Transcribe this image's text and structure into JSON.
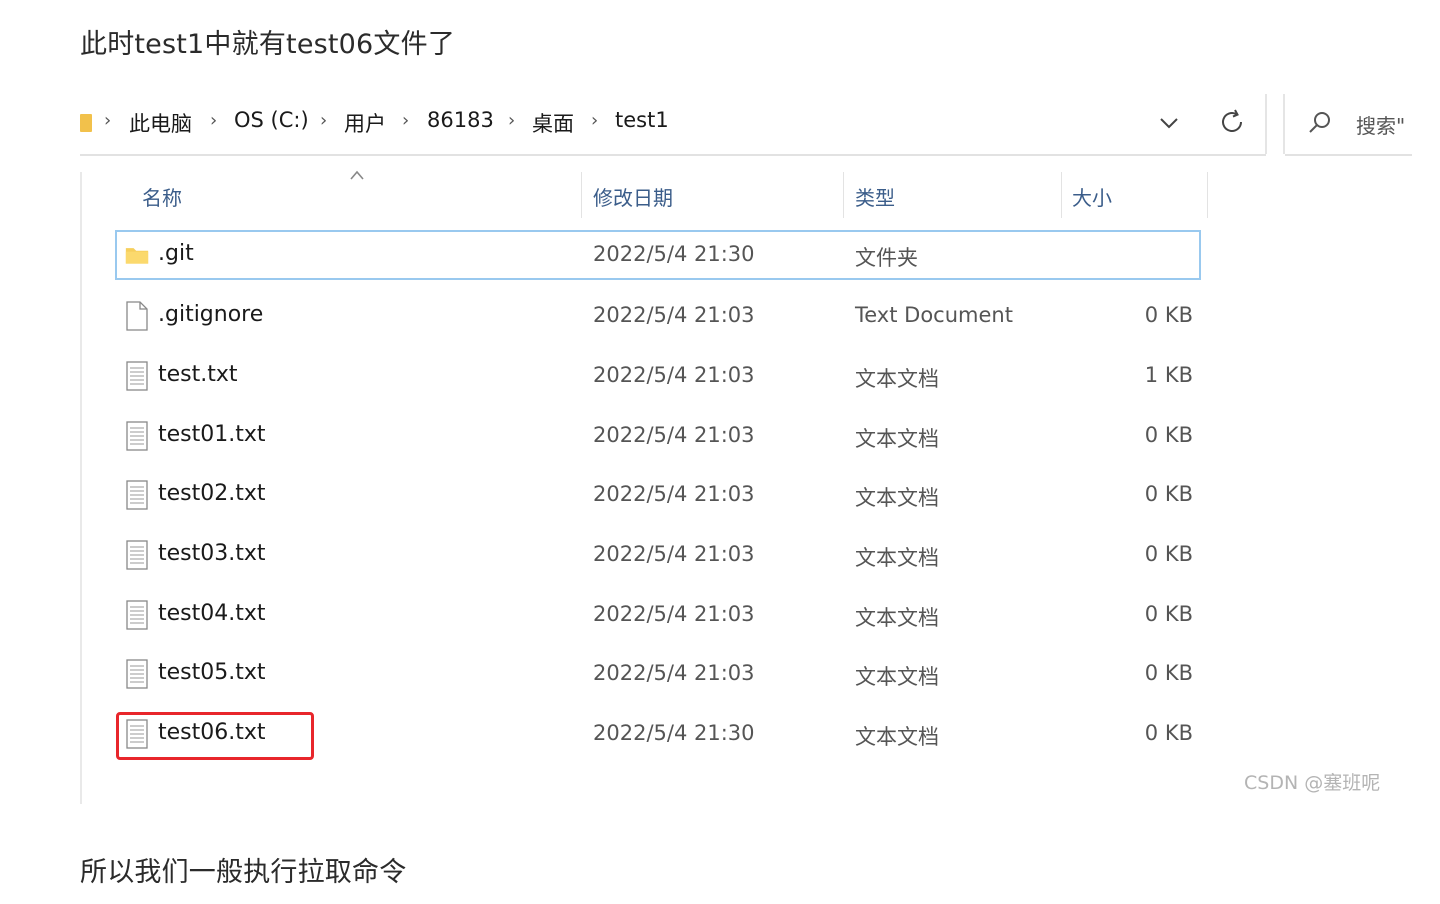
{
  "article": {
    "para_top": "此时test1中就有test06文件了",
    "para_bottom": "所以我们一般执行拉取命令",
    "watermark": "CSDN @塞班呢"
  },
  "address_bar": {
    "breadcrumbs": [
      "此电脑",
      "OS (C:)",
      "用户",
      "86183",
      "桌面",
      "test1"
    ],
    "search_placeholder": "搜索\""
  },
  "columns": {
    "name": "名称",
    "date": "修改日期",
    "type": "类型",
    "size": "大小"
  },
  "files": [
    {
      "name": ".git",
      "date": "2022/5/4 21:30",
      "type": "文件夹",
      "size": "",
      "icon": "folder-icon",
      "selected": true
    },
    {
      "name": ".gitignore",
      "date": "2022/5/4 21:03",
      "type": "Text Document",
      "size": "0 KB",
      "icon": "document-icon"
    },
    {
      "name": "test.txt",
      "date": "2022/5/4 21:03",
      "type": "文本文档",
      "size": "1 KB",
      "icon": "text-file-icon"
    },
    {
      "name": "test01.txt",
      "date": "2022/5/4 21:03",
      "type": "文本文档",
      "size": "0 KB",
      "icon": "text-file-icon"
    },
    {
      "name": "test02.txt",
      "date": "2022/5/4 21:03",
      "type": "文本文档",
      "size": "0 KB",
      "icon": "text-file-icon"
    },
    {
      "name": "test03.txt",
      "date": "2022/5/4 21:03",
      "type": "文本文档",
      "size": "0 KB",
      "icon": "text-file-icon"
    },
    {
      "name": "test04.txt",
      "date": "2022/5/4 21:03",
      "type": "文本文档",
      "size": "0 KB",
      "icon": "text-file-icon"
    },
    {
      "name": "test05.txt",
      "date": "2022/5/4 21:03",
      "type": "文本文档",
      "size": "0 KB",
      "icon": "text-file-icon"
    },
    {
      "name": "test06.txt",
      "date": "2022/5/4 21:30",
      "type": "文本文档",
      "size": "0 KB",
      "icon": "text-file-icon",
      "highlighted": true
    }
  ],
  "colors": {
    "highlight": "#e8262b",
    "selection_border": "#99c9ef",
    "header_text": "#3b5d8a"
  }
}
